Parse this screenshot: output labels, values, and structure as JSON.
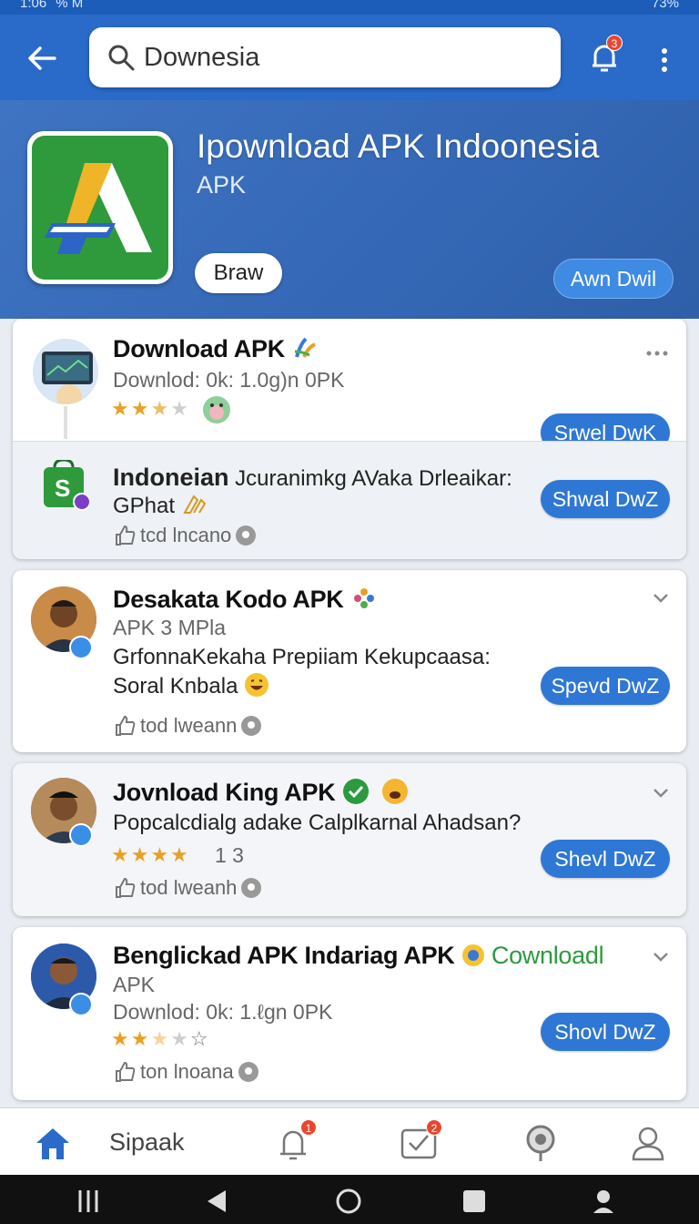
{
  "status": {
    "time": "1:06",
    "left_extra": "% M",
    "battery": "73%"
  },
  "search": {
    "value": "Downesia",
    "placeholder": ""
  },
  "notifications": {
    "count": "3"
  },
  "hero": {
    "title": "Ipownload APK Indoonesia",
    "subtitle": "APK",
    "browse_label": "Braw",
    "action_label": "Awn Dwil",
    "brand_color": "#2f9a3b"
  },
  "cards": [
    {
      "title": "Download APK",
      "line1": "Downlod: 0k: 1.0g)n 0PK",
      "rating": 3,
      "sub_title": "Indoneian",
      "sub_line1": "Jcuranimkg AVaka Drleaikar:",
      "sub_line2": "GPhat",
      "sub_meta": "tcd lncano",
      "button1": "Srwel DwK",
      "button2": "Shwal DwZ"
    },
    {
      "title": "Desakata Kodo APK",
      "line1": "APK 3 MPla",
      "line2": "GrfonnaKekaha Prepiiam Kekupcaasa:",
      "line3": "Soral Knbala",
      "meta": "tod lweann",
      "button": "Spevd DwZ"
    },
    {
      "title": "Jovnload King APK",
      "line1": "Popcalcdialg adake Calplkarnal Ahadsan?",
      "rating": 4,
      "rating_text": "1 3",
      "meta": "tod lweanh",
      "button": "Shevl DwZ"
    },
    {
      "title": "Benglickad APK Indariag APK",
      "title_extra": "Cownloadl",
      "line1": "APK",
      "line2": "Downlod: 0k: 1.ℓgn 0PK",
      "rating": 2,
      "meta": "ton lnoana",
      "button": "Shovl DwZ"
    }
  ],
  "bottom_nav": {
    "label": "Sipaak",
    "badge1": "1",
    "badge2": "2"
  }
}
